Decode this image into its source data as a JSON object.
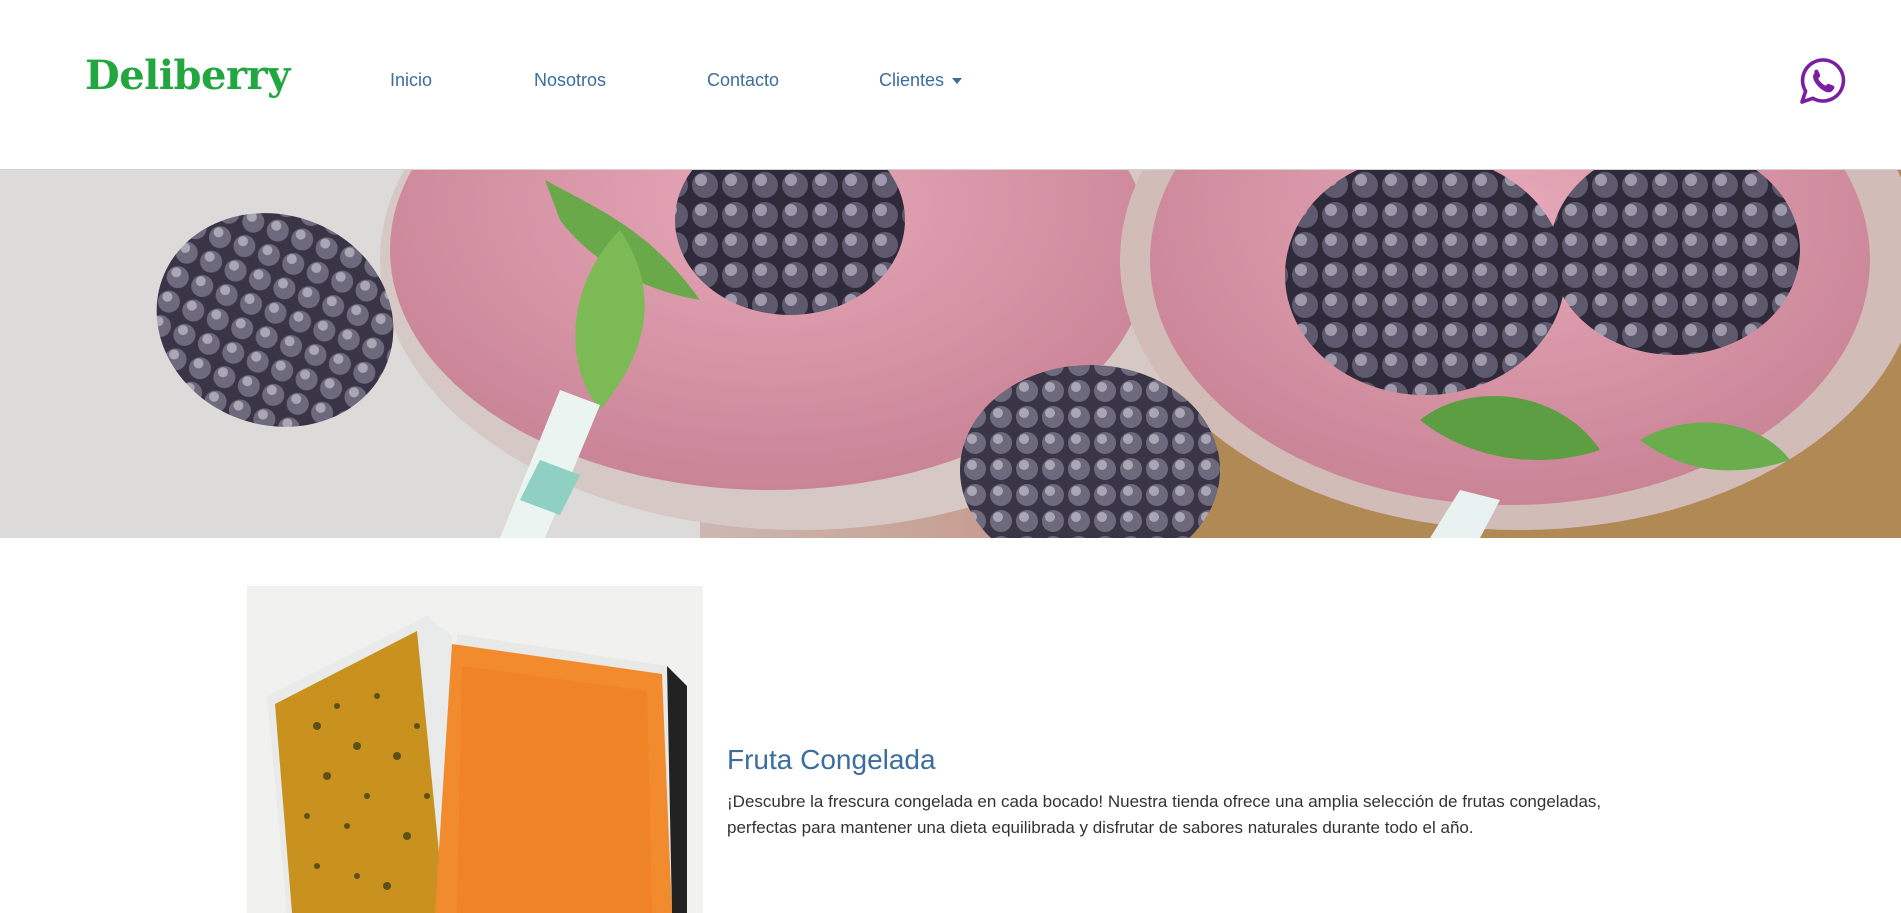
{
  "brand": {
    "name": "Deliberry",
    "color": "#22a640"
  },
  "nav": {
    "items": [
      {
        "label": "Inicio"
      },
      {
        "label": "Nosotros"
      },
      {
        "label": "Contacto"
      },
      {
        "label": "Clientes",
        "has_dropdown": true
      }
    ],
    "link_color": "#3b6d9e"
  },
  "whatsapp": {
    "icon": "whatsapp-icon",
    "color": "#7b1fa2"
  },
  "hero": {
    "image": "frozen-blackberries-smoothie-banner"
  },
  "product": {
    "image": "frozen-fruit-pulp-packs",
    "title": "Fruta Congelada",
    "description": "¡Descubre la frescura congelada en cada bocado! Nuestra tienda ofrece una amplia selección de frutas congeladas, perfectas para mantener una dieta equilibrada y disfrutar de sabores naturales durante todo el año."
  }
}
